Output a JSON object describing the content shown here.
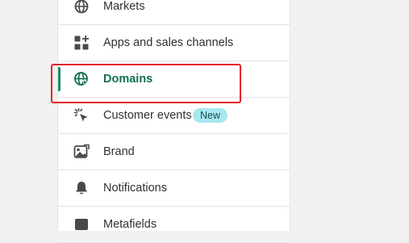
{
  "nav": {
    "items": [
      {
        "label": "Markets",
        "icon": "globe-icon"
      },
      {
        "label": "Apps and sales channels",
        "icon": "apps-icon"
      },
      {
        "label": "Domains",
        "icon": "domain-globe-icon",
        "active": true
      },
      {
        "label": "Customer events",
        "icon": "cursor-click-icon",
        "badge": "New"
      },
      {
        "label": "Brand",
        "icon": "brand-image-icon"
      },
      {
        "label": "Notifications",
        "icon": "bell-icon"
      },
      {
        "label": "Metafields",
        "icon": "metafields-icon"
      }
    ]
  },
  "colors": {
    "active_text": "#0d6e55",
    "active_bar": "#1c8a6b",
    "highlight_box": "#e4262b",
    "badge_bg": "#a8e8f0"
  }
}
